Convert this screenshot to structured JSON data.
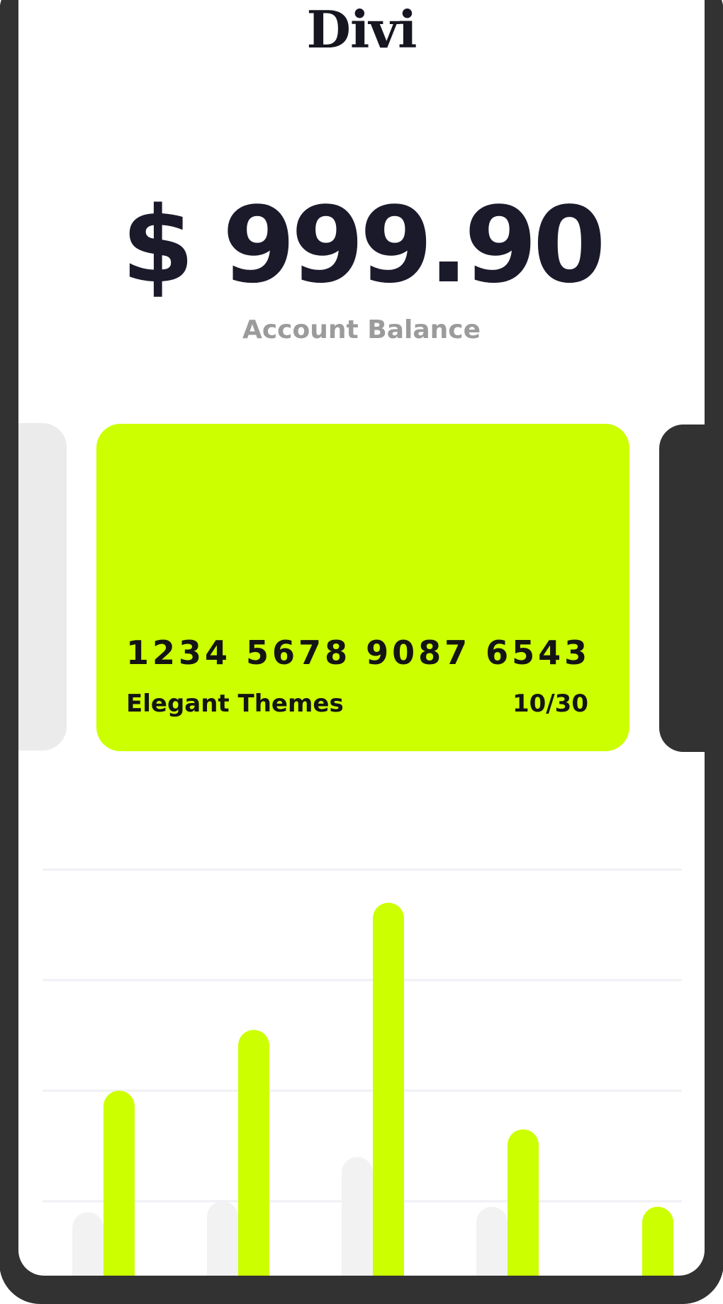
{
  "app": {
    "logo_text": "Divi"
  },
  "balance": {
    "amount": "$ 999.90",
    "label": "Account Balance"
  },
  "card": {
    "number": "1234 5678 9087 6543",
    "holder": "Elegant Themes",
    "expiry": "10/30",
    "accent_color": "#ccff00"
  },
  "colors": {
    "background": "#ffffff",
    "frame": "#323232",
    "text_dark": "#1b1a2b",
    "text_muted": "#9b9b9b",
    "card_peek_left": "#ebebeb",
    "series_secondary": "#f2f2f2",
    "series_primary": "#ccff00",
    "gridline": "#f0f1f6"
  },
  "chart_data": {
    "type": "bar",
    "title": "",
    "xlabel": "",
    "ylabel": "",
    "categories": [
      "",
      "",
      "",
      "",
      ""
    ],
    "ylim": [
      0,
      4
    ],
    "gridlines": [
      1,
      2,
      3,
      4
    ],
    "series": [
      {
        "color": "#f2f2f2",
        "values": [
          0.9,
          1.0,
          1.4,
          0.95,
          0.3
        ]
      },
      {
        "color": "#ccff00",
        "values": [
          2.0,
          2.55,
          3.7,
          1.65,
          0.95
        ]
      }
    ]
  }
}
